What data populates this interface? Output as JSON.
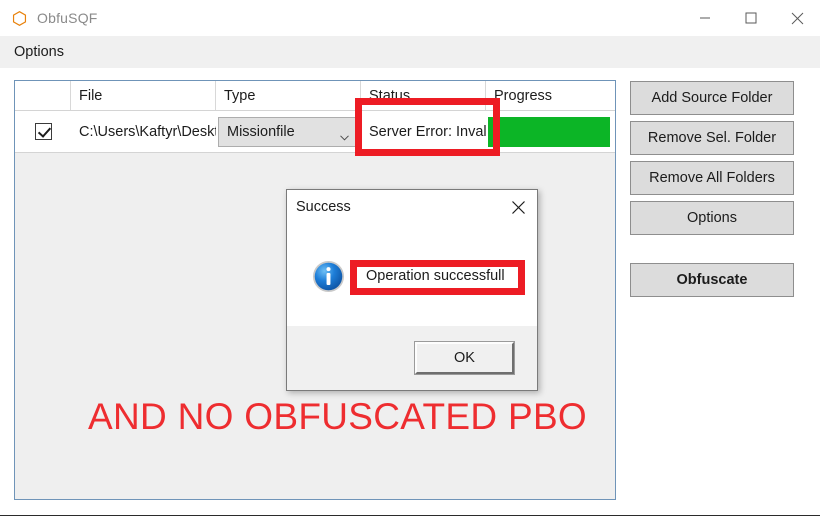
{
  "window": {
    "title": "ObfuSQF",
    "app_icon": "hexagon-icon",
    "accent_color": "#e8820c",
    "controls": {
      "minimize": "minimize-icon",
      "maximize": "maximize-icon",
      "close": "close-icon"
    }
  },
  "menubar": {
    "items": [
      {
        "label": "Options"
      }
    ]
  },
  "grid": {
    "columns": [
      "",
      "File",
      "Type",
      "Status",
      "Progress"
    ],
    "rows": [
      {
        "selected": true,
        "file": "C:\\Users\\Kaftyr\\Deskt",
        "type": "Missionfile",
        "status": "Server Error: Inval",
        "progress": 100,
        "progress_color": "#0cb526"
      }
    ]
  },
  "side_buttons": [
    {
      "label": "Add Source Folder",
      "bold": false
    },
    {
      "label": "Remove Sel. Folder",
      "bold": false
    },
    {
      "label": "Remove All Folders",
      "bold": false
    },
    {
      "label": "Options",
      "bold": false
    },
    {
      "label": "Obfuscate",
      "bold": true
    }
  ],
  "dialog": {
    "title": "Success",
    "close_icon": "close-icon",
    "info_icon": "info-icon",
    "message": "Operation successfull",
    "ok_label": "OK"
  },
  "annotations": {
    "color": "#ed1c24",
    "caption": "AND NO OBFUSCATED PBO",
    "boxes": [
      {
        "target": "status-cell-text"
      },
      {
        "target": "dialog-message-text"
      }
    ]
  }
}
